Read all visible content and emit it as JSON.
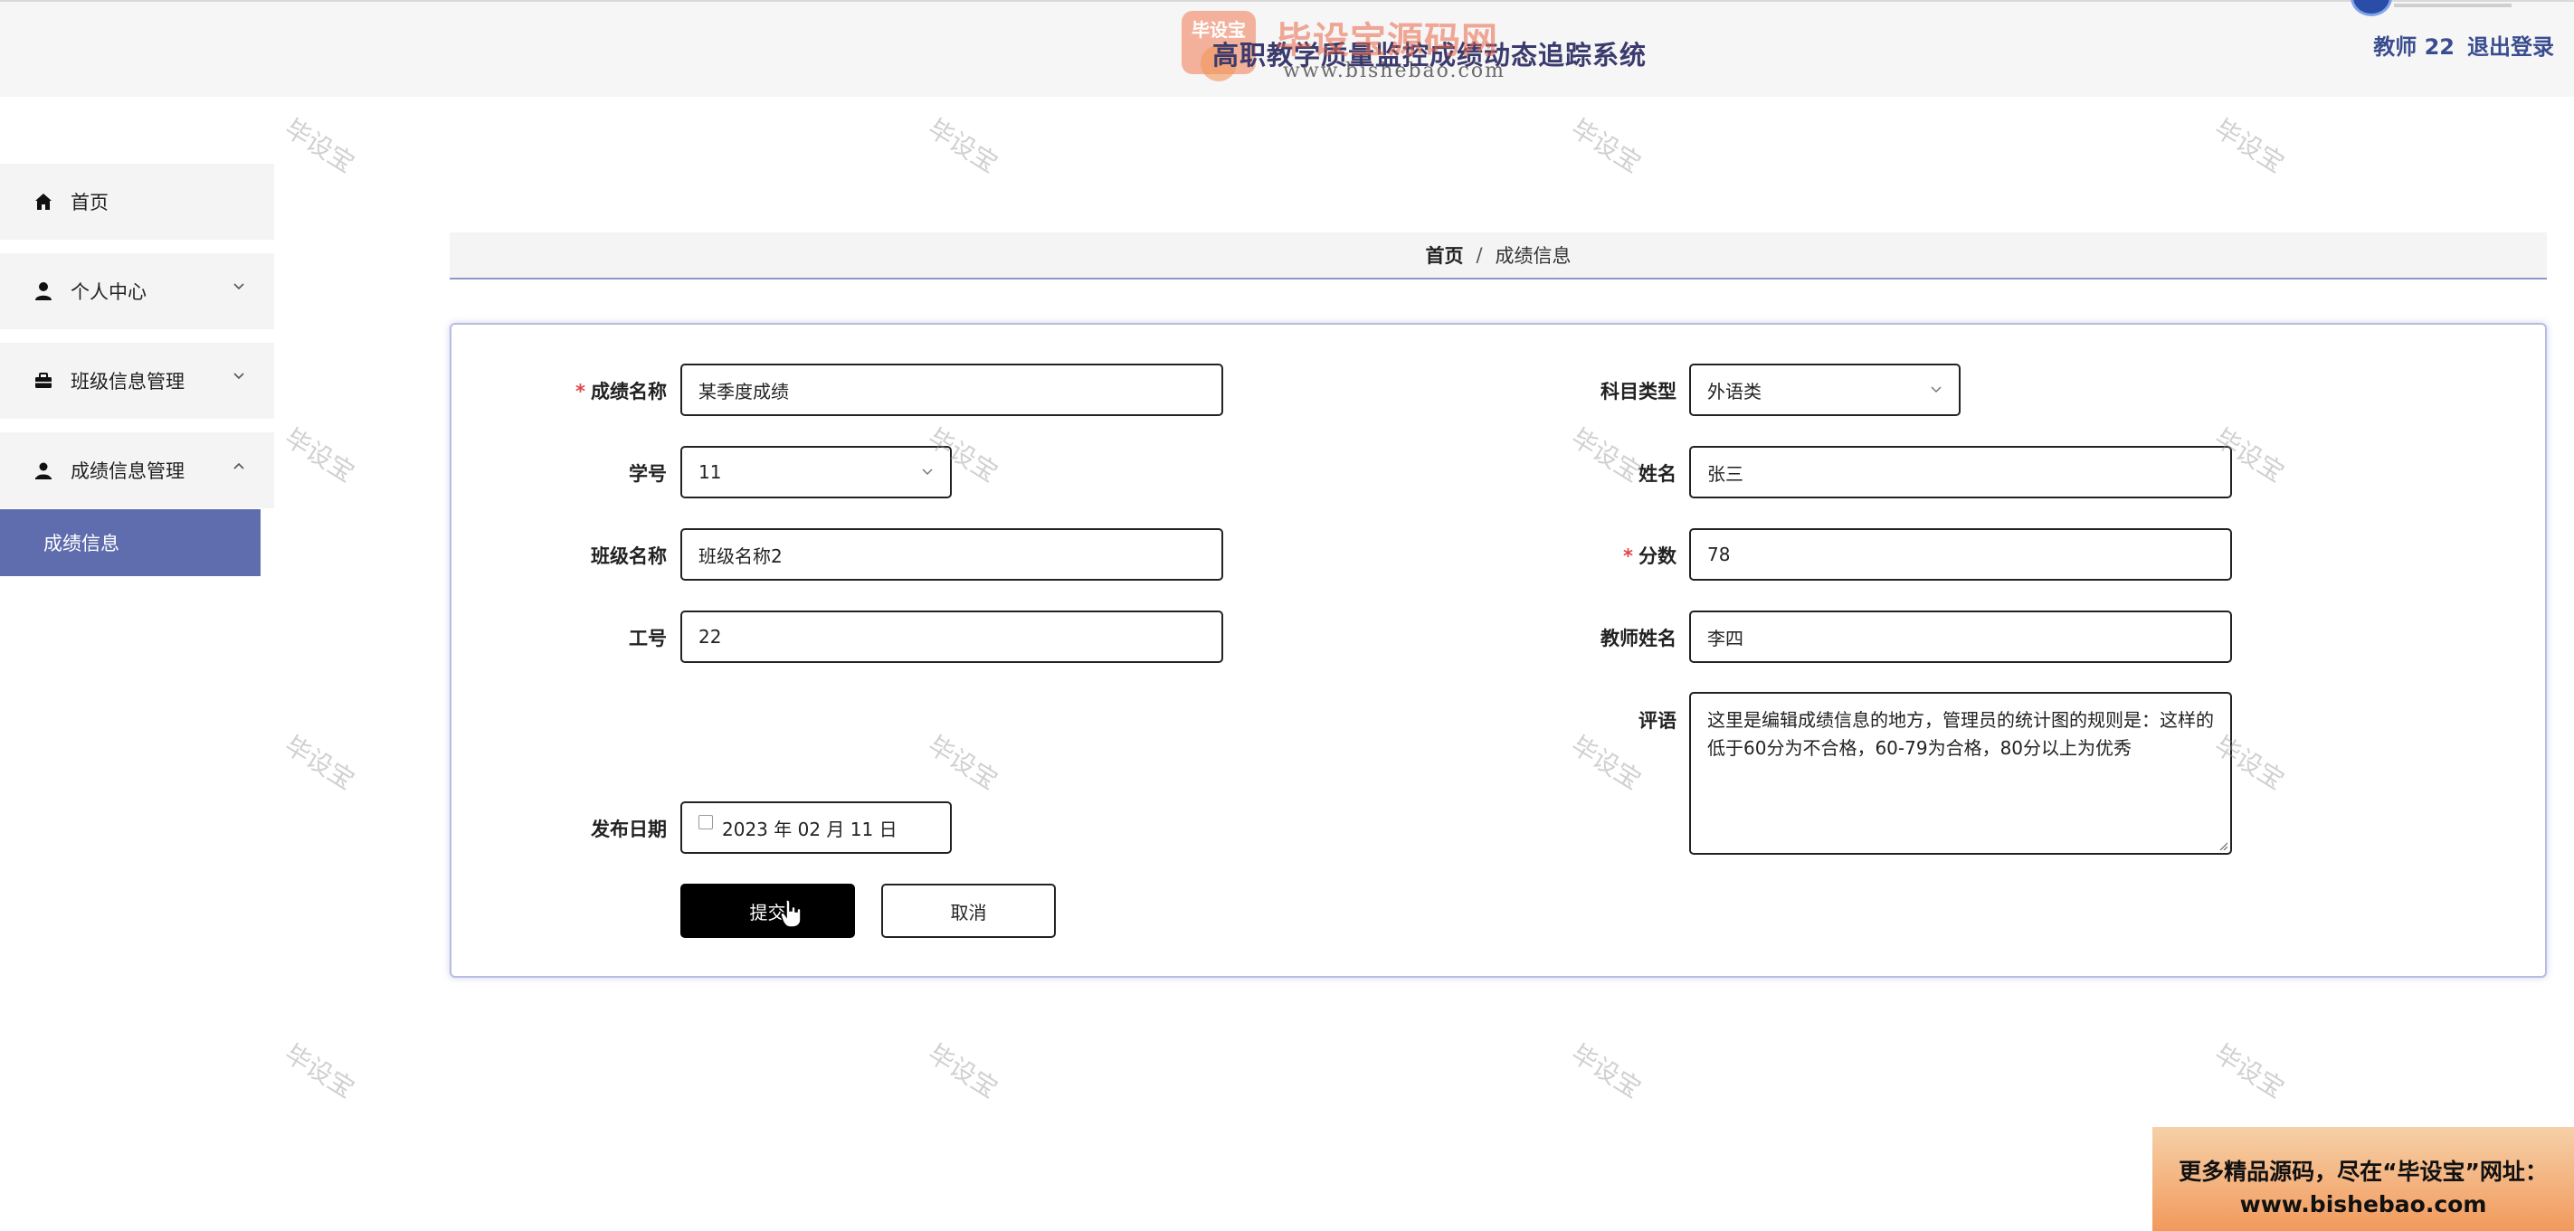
{
  "header": {
    "app_title": "高职教学质量监控成绩动态追踪系统",
    "user_label": "教师 22",
    "logout_label": "退出登录"
  },
  "watermark": {
    "logo_badge": "毕设宝",
    "logo_text": "毕设宝源码网",
    "logo_url": "www.bishebao.com",
    "tile_text": "毕设宝"
  },
  "sidebar": {
    "items": [
      {
        "label": "首页",
        "icon": "home-icon",
        "expandable": false
      },
      {
        "label": "个人中心",
        "icon": "user-icon",
        "expandable": true,
        "expanded": false
      },
      {
        "label": "班级信息管理",
        "icon": "briefcase-icon",
        "expandable": true,
        "expanded": false
      },
      {
        "label": "成绩信息管理",
        "icon": "user-icon",
        "expandable": true,
        "expanded": true
      }
    ],
    "active_subitem": "成绩信息"
  },
  "breadcrumb": {
    "home": "首页",
    "separator": "/",
    "current": "成绩信息"
  },
  "form": {
    "score_name": {
      "label": "成绩名称",
      "required": true,
      "value": "某季度成绩"
    },
    "subject_type": {
      "label": "科目类型",
      "required": false,
      "value": "外语类"
    },
    "student_id": {
      "label": "学号",
      "required": false,
      "value": "11"
    },
    "student_name": {
      "label": "姓名",
      "required": false,
      "value": "张三"
    },
    "class_name": {
      "label": "班级名称",
      "required": false,
      "value": "班级名称2"
    },
    "score": {
      "label": "分数",
      "required": true,
      "value": "78"
    },
    "staff_id": {
      "label": "工号",
      "required": false,
      "value": "22"
    },
    "teacher_name": {
      "label": "教师姓名",
      "required": false,
      "value": "李四"
    },
    "comment": {
      "label": "评语",
      "value": "这里是编辑成绩信息的地方，管理员的统计图的规则是：这样的低于60分为不合格，60-79为合格，80分以上为优秀"
    },
    "publish_date": {
      "label": "发布日期",
      "value": "2023 年 02 月 11 日"
    },
    "required_mark": "*",
    "submit_label": "提交",
    "cancel_label": "取消"
  },
  "promo": {
    "line1": "更多精品源码，尽在“毕设宝”网址：",
    "line2": "www.bishebao.com"
  },
  "colors": {
    "accent": "#5f6dae",
    "breadcrumb_rule": "#8e97c9",
    "required": "#e04848",
    "user_text": "#3a4d8f"
  }
}
